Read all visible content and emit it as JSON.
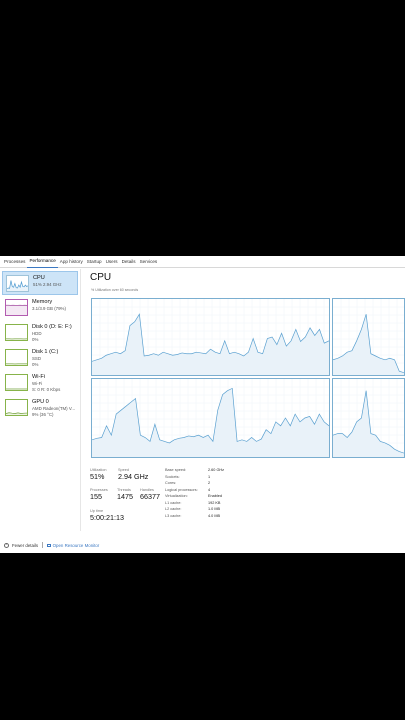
{
  "tabs": [
    "Processes",
    "Performance",
    "App history",
    "Startup",
    "Users",
    "Details",
    "Services"
  ],
  "active_tab": 1,
  "sidebar": [
    {
      "title": "CPU",
      "sub1": "51% 2.94 GHz",
      "sub2": "",
      "kind": "cpu",
      "points": [
        0.85,
        0.8,
        0.82,
        0.3,
        0.7,
        0.75,
        0.5,
        0.78,
        0.8,
        0.6,
        0.75,
        0.4,
        0.7,
        0.72,
        0.6,
        0.7,
        0.65
      ]
    },
    {
      "title": "Memory",
      "sub1": "3.1/3.9 GB (79%)",
      "sub2": "",
      "kind": "mem",
      "points": [
        0.35,
        0.35,
        0.36,
        0.35,
        0.36,
        0.36,
        0.35,
        0.36,
        0.35,
        0.36
      ]
    },
    {
      "title": "Disk 0 (D: E: F:)",
      "sub1": "HDD",
      "sub2": "0%",
      "kind": "disk",
      "points": [
        0.92,
        0.92,
        0.93,
        0.92,
        0.92,
        0.92,
        0.93,
        0.92
      ]
    },
    {
      "title": "Disk 1 (C:)",
      "sub1": "SSD",
      "sub2": "0%",
      "kind": "disk",
      "points": [
        0.92,
        0.92,
        0.92,
        0.93,
        0.92,
        0.92,
        0.92,
        0.92
      ]
    },
    {
      "title": "Wi-Fi",
      "sub1": "Wi-Fi",
      "sub2": "S: 0 R: 0 Kbps",
      "kind": "wifi",
      "points": [
        0.93,
        0.93,
        0.93,
        0.93,
        0.93,
        0.93
      ]
    },
    {
      "title": "GPU 0",
      "sub1": "AMD Radeon(TM) V...",
      "sub2": "9% (36 °C)",
      "kind": "gpu",
      "points": [
        0.9,
        0.85,
        0.88,
        0.9,
        0.86,
        0.9,
        0.88,
        0.87
      ]
    }
  ],
  "main": {
    "title": "CPU",
    "graph_caption": "% Utilization over 60 seconds",
    "stats": [
      {
        "label": "Utilization",
        "value": "51%"
      },
      {
        "label": "Speed",
        "value": "2.94 GHz"
      },
      {
        "label": "Processes",
        "value": "155"
      },
      {
        "label": "Threads",
        "value": "1475"
      },
      {
        "label": "Handles",
        "value": "66377"
      },
      {
        "label": "Up time",
        "value": "5:00:21:13"
      }
    ],
    "specs": [
      {
        "label": "Base speed:",
        "value": "2.60 GHz"
      },
      {
        "label": "Sockets:",
        "value": "1"
      },
      {
        "label": "Cores:",
        "value": "2"
      },
      {
        "label": "Logical processors:",
        "value": "4"
      },
      {
        "label": "Virtualization:",
        "value": "Enabled"
      },
      {
        "label": "L1 cache:",
        "value": "192 KB"
      },
      {
        "label": "L2 cache:",
        "value": "1.0 MB"
      },
      {
        "label": "L3 cache:",
        "value": "4.0 MB"
      }
    ]
  },
  "cpu_graphs": [
    [
      0.82,
      0.8,
      0.78,
      0.74,
      0.72,
      0.7,
      0.72,
      0.68,
      0.35,
      0.3,
      0.2,
      0.75,
      0.74,
      0.72,
      0.74,
      0.7,
      0.72,
      0.74,
      0.73,
      0.71,
      0.72,
      0.72,
      0.7,
      0.71,
      0.72,
      0.66,
      0.7,
      0.72,
      0.55,
      0.72,
      0.7,
      0.72,
      0.75,
      0.7,
      0.52,
      0.7,
      0.72,
      0.52,
      0.5,
      0.6,
      0.45,
      0.62,
      0.55,
      0.4,
      0.56,
      0.5,
      0.38,
      0.48,
      0.4,
      0.58,
      0.55
    ],
    [
      0.8,
      0.78,
      0.75,
      0.7,
      0.68,
      0.55,
      0.4,
      0.2,
      0.72,
      0.75,
      0.78,
      0.8,
      0.78,
      0.8,
      0.95,
      0.97
    ],
    [
      0.78,
      0.76,
      0.75,
      0.6,
      0.72,
      0.45,
      0.4,
      0.35,
      0.3,
      0.25,
      0.72,
      0.75,
      0.8,
      0.58,
      0.78,
      0.8,
      0.82,
      0.78,
      0.76,
      0.75,
      0.73,
      0.74,
      0.72,
      0.75,
      0.72,
      0.8,
      0.4,
      0.2,
      0.15,
      0.12,
      0.8,
      0.78,
      0.8,
      0.75,
      0.8,
      0.77,
      0.65,
      0.7,
      0.55,
      0.6,
      0.5,
      0.6,
      0.45,
      0.55,
      0.5,
      0.48,
      0.58,
      0.45,
      0.55,
      0.6
    ],
    [
      0.72,
      0.7,
      0.7,
      0.75,
      0.68,
      0.55,
      0.5,
      0.15,
      0.7,
      0.72,
      0.8,
      0.82,
      0.85,
      0.9,
      0.93,
      0.95
    ]
  ],
  "footer": {
    "fewer_details": "Fewer details",
    "open_monitor": "Open Resource Monitor"
  }
}
